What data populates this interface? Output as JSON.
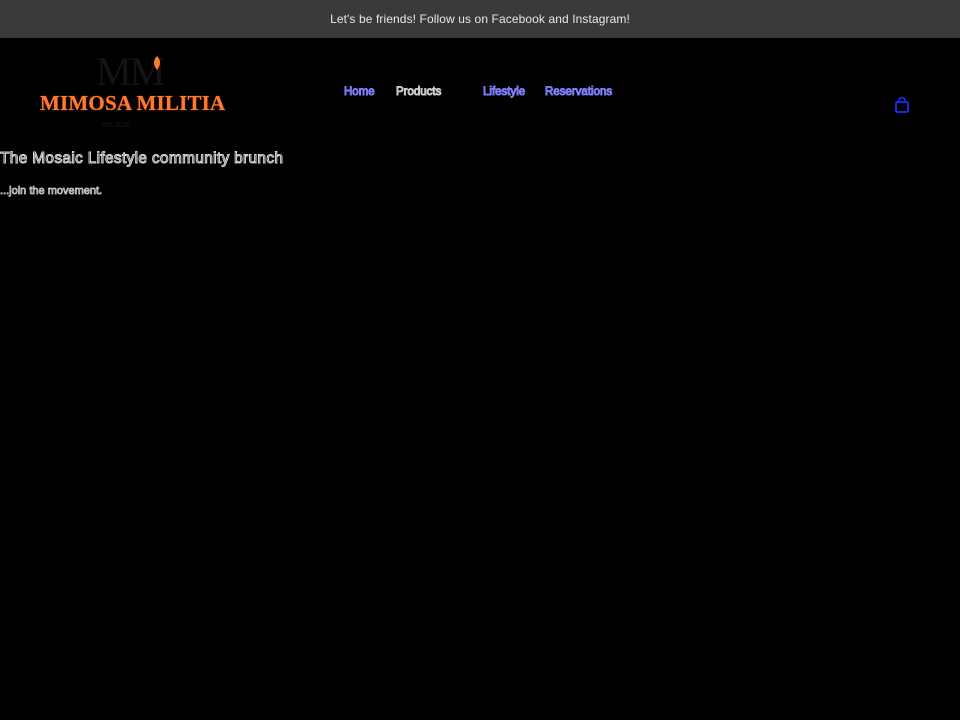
{
  "announcement": {
    "text": "Let's be friends! Follow us on Facebook and Instagram!"
  },
  "brand": {
    "monogram": "MM",
    "name": "MIMOSA MILITIA",
    "tagline": "est. 2020"
  },
  "nav": {
    "items": [
      {
        "label": "Home"
      },
      {
        "label": "Products"
      },
      {
        "label": "Lifestyle"
      },
      {
        "label": "Reservations"
      }
    ]
  },
  "cart": {
    "icon": "shopping-bag-icon"
  },
  "hero": {
    "title": "The Mosaic Lifestyle community brunch",
    "subtitle": "...join the movement."
  },
  "colors": {
    "background": "#000000",
    "announcement_bg": "#3a3a3a",
    "brand_orange": "#ff7a2f",
    "link_blue": "#7f7fff",
    "cart_blue": "#1a2cff"
  }
}
